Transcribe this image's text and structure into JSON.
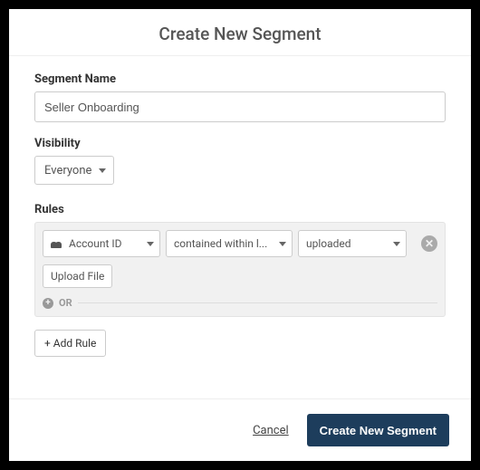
{
  "modal": {
    "title": "Create New Segment"
  },
  "fields": {
    "segment_name": {
      "label": "Segment Name",
      "value": "Seller Onboarding"
    },
    "visibility": {
      "label": "Visibility",
      "selected": "Everyone"
    }
  },
  "rules": {
    "label": "Rules",
    "items": [
      {
        "property": "Account ID",
        "operator": "contained within l...",
        "value": "uploaded",
        "upload_label": "Upload File"
      }
    ],
    "or_label": "OR",
    "add_rule_label": "+ Add Rule"
  },
  "footer": {
    "cancel": "Cancel",
    "submit": "Create New Segment"
  }
}
